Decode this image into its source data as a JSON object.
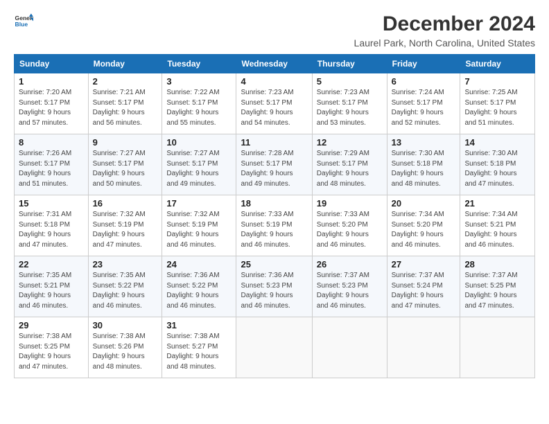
{
  "logo": {
    "line1": "General",
    "line2": "Blue"
  },
  "title": "December 2024",
  "subtitle": "Laurel Park, North Carolina, United States",
  "weekdays": [
    "Sunday",
    "Monday",
    "Tuesday",
    "Wednesday",
    "Thursday",
    "Friday",
    "Saturday"
  ],
  "weeks": [
    [
      {
        "day": "1",
        "info": "Sunrise: 7:20 AM\nSunset: 5:17 PM\nDaylight: 9 hours\nand 57 minutes."
      },
      {
        "day": "2",
        "info": "Sunrise: 7:21 AM\nSunset: 5:17 PM\nDaylight: 9 hours\nand 56 minutes."
      },
      {
        "day": "3",
        "info": "Sunrise: 7:22 AM\nSunset: 5:17 PM\nDaylight: 9 hours\nand 55 minutes."
      },
      {
        "day": "4",
        "info": "Sunrise: 7:23 AM\nSunset: 5:17 PM\nDaylight: 9 hours\nand 54 minutes."
      },
      {
        "day": "5",
        "info": "Sunrise: 7:23 AM\nSunset: 5:17 PM\nDaylight: 9 hours\nand 53 minutes."
      },
      {
        "day": "6",
        "info": "Sunrise: 7:24 AM\nSunset: 5:17 PM\nDaylight: 9 hours\nand 52 minutes."
      },
      {
        "day": "7",
        "info": "Sunrise: 7:25 AM\nSunset: 5:17 PM\nDaylight: 9 hours\nand 51 minutes."
      }
    ],
    [
      {
        "day": "8",
        "info": "Sunrise: 7:26 AM\nSunset: 5:17 PM\nDaylight: 9 hours\nand 51 minutes."
      },
      {
        "day": "9",
        "info": "Sunrise: 7:27 AM\nSunset: 5:17 PM\nDaylight: 9 hours\nand 50 minutes."
      },
      {
        "day": "10",
        "info": "Sunrise: 7:27 AM\nSunset: 5:17 PM\nDaylight: 9 hours\nand 49 minutes."
      },
      {
        "day": "11",
        "info": "Sunrise: 7:28 AM\nSunset: 5:17 PM\nDaylight: 9 hours\nand 49 minutes."
      },
      {
        "day": "12",
        "info": "Sunrise: 7:29 AM\nSunset: 5:17 PM\nDaylight: 9 hours\nand 48 minutes."
      },
      {
        "day": "13",
        "info": "Sunrise: 7:30 AM\nSunset: 5:18 PM\nDaylight: 9 hours\nand 48 minutes."
      },
      {
        "day": "14",
        "info": "Sunrise: 7:30 AM\nSunset: 5:18 PM\nDaylight: 9 hours\nand 47 minutes."
      }
    ],
    [
      {
        "day": "15",
        "info": "Sunrise: 7:31 AM\nSunset: 5:18 PM\nDaylight: 9 hours\nand 47 minutes."
      },
      {
        "day": "16",
        "info": "Sunrise: 7:32 AM\nSunset: 5:19 PM\nDaylight: 9 hours\nand 47 minutes."
      },
      {
        "day": "17",
        "info": "Sunrise: 7:32 AM\nSunset: 5:19 PM\nDaylight: 9 hours\nand 46 minutes."
      },
      {
        "day": "18",
        "info": "Sunrise: 7:33 AM\nSunset: 5:19 PM\nDaylight: 9 hours\nand 46 minutes."
      },
      {
        "day": "19",
        "info": "Sunrise: 7:33 AM\nSunset: 5:20 PM\nDaylight: 9 hours\nand 46 minutes."
      },
      {
        "day": "20",
        "info": "Sunrise: 7:34 AM\nSunset: 5:20 PM\nDaylight: 9 hours\nand 46 minutes."
      },
      {
        "day": "21",
        "info": "Sunrise: 7:34 AM\nSunset: 5:21 PM\nDaylight: 9 hours\nand 46 minutes."
      }
    ],
    [
      {
        "day": "22",
        "info": "Sunrise: 7:35 AM\nSunset: 5:21 PM\nDaylight: 9 hours\nand 46 minutes."
      },
      {
        "day": "23",
        "info": "Sunrise: 7:35 AM\nSunset: 5:22 PM\nDaylight: 9 hours\nand 46 minutes."
      },
      {
        "day": "24",
        "info": "Sunrise: 7:36 AM\nSunset: 5:22 PM\nDaylight: 9 hours\nand 46 minutes."
      },
      {
        "day": "25",
        "info": "Sunrise: 7:36 AM\nSunset: 5:23 PM\nDaylight: 9 hours\nand 46 minutes."
      },
      {
        "day": "26",
        "info": "Sunrise: 7:37 AM\nSunset: 5:23 PM\nDaylight: 9 hours\nand 46 minutes."
      },
      {
        "day": "27",
        "info": "Sunrise: 7:37 AM\nSunset: 5:24 PM\nDaylight: 9 hours\nand 47 minutes."
      },
      {
        "day": "28",
        "info": "Sunrise: 7:37 AM\nSunset: 5:25 PM\nDaylight: 9 hours\nand 47 minutes."
      }
    ],
    [
      {
        "day": "29",
        "info": "Sunrise: 7:38 AM\nSunset: 5:25 PM\nDaylight: 9 hours\nand 47 minutes."
      },
      {
        "day": "30",
        "info": "Sunrise: 7:38 AM\nSunset: 5:26 PM\nDaylight: 9 hours\nand 48 minutes."
      },
      {
        "day": "31",
        "info": "Sunrise: 7:38 AM\nSunset: 5:27 PM\nDaylight: 9 hours\nand 48 minutes."
      },
      null,
      null,
      null,
      null
    ]
  ]
}
